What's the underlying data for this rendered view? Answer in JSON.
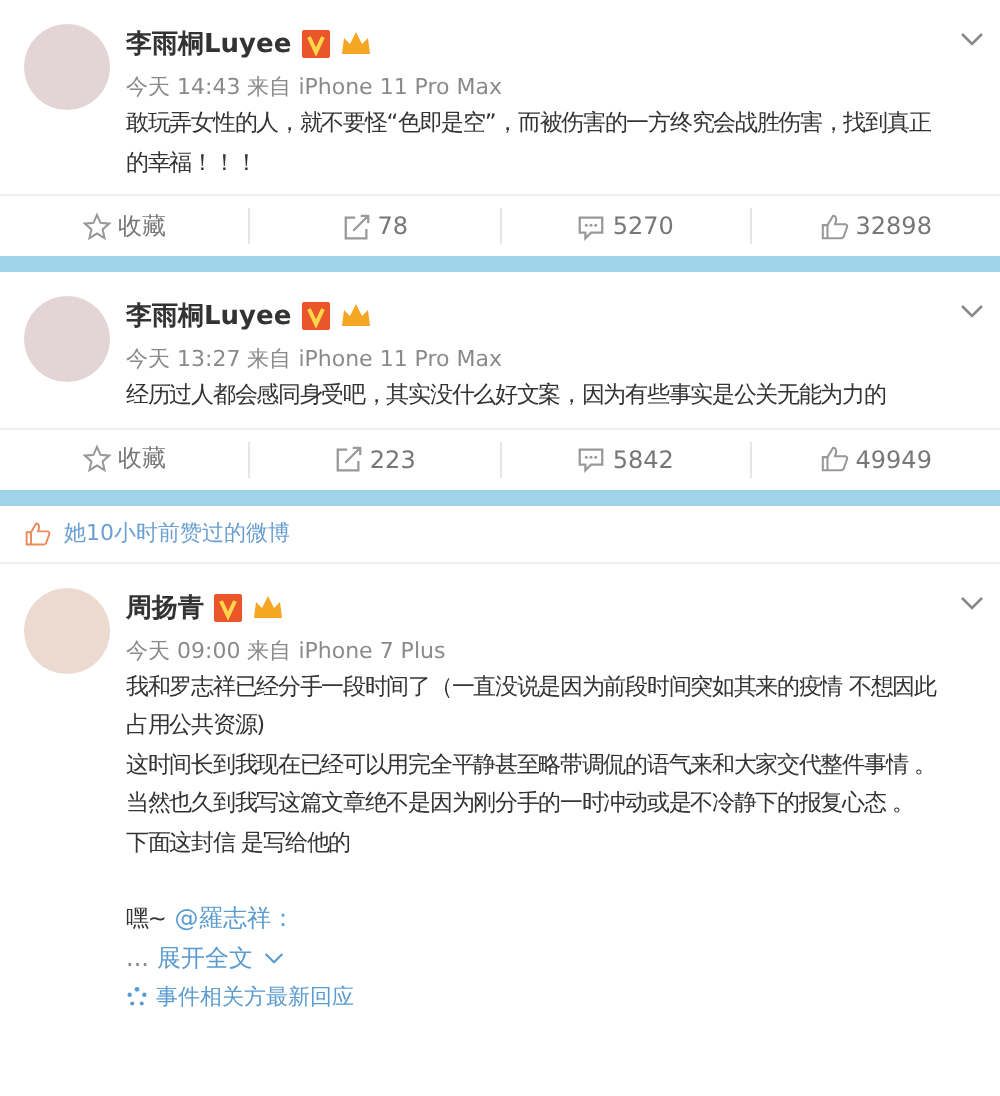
{
  "posts": [
    {
      "author": "李雨桐Luyee",
      "time": "今天 14:43",
      "source": "来自 iPhone 11 Pro Max",
      "text": "敢玩弄女性的人，就不要怪“色即是空”，而被伤害的一方终究会战胜伤害，找到真正的幸福！！！",
      "actions": [
        {
          "kind": "favorite",
          "label": "收藏"
        },
        {
          "kind": "repost",
          "label": "78"
        },
        {
          "kind": "comment",
          "label": "5270"
        },
        {
          "kind": "like",
          "label": "32898"
        }
      ]
    },
    {
      "author": "李雨桐Luyee",
      "time": "今天 13:27",
      "source": "来自 iPhone 11 Pro Max",
      "text": "经历过人都会感同身受吧，其实没什么好文案，因为有些事实是公关无能为力的",
      "actions": [
        {
          "kind": "favorite",
          "label": "收藏"
        },
        {
          "kind": "repost",
          "label": "223"
        },
        {
          "kind": "comment",
          "label": "5842"
        },
        {
          "kind": "like",
          "label": "49949"
        }
      ]
    }
  ],
  "liked_notice": "她10小时前赞过的微博",
  "liked_post": {
    "author": "周扬青",
    "time": "今天 09:00",
    "source": "来自 iPhone 7 Plus",
    "paragraphs": [
      "我和罗志祥已经分手一段时间了（一直没说是因为前段时间突如其来的疫情 不想因此占用公共资源)",
      "这时间长到我现在已经可以用完全平静甚至略带调侃的语气来和大家交代整件事情 。当然也久到我写这篇文章绝不是因为刚分手的一时冲动或是不冷静下的报复心态 。",
      "下面这封信 是写给他的"
    ],
    "greeting": "嘿~",
    "mention": "@羅志祥：",
    "ellipsis": "...",
    "expand": "展开全文",
    "event_link": "事件相关方最新回应"
  }
}
